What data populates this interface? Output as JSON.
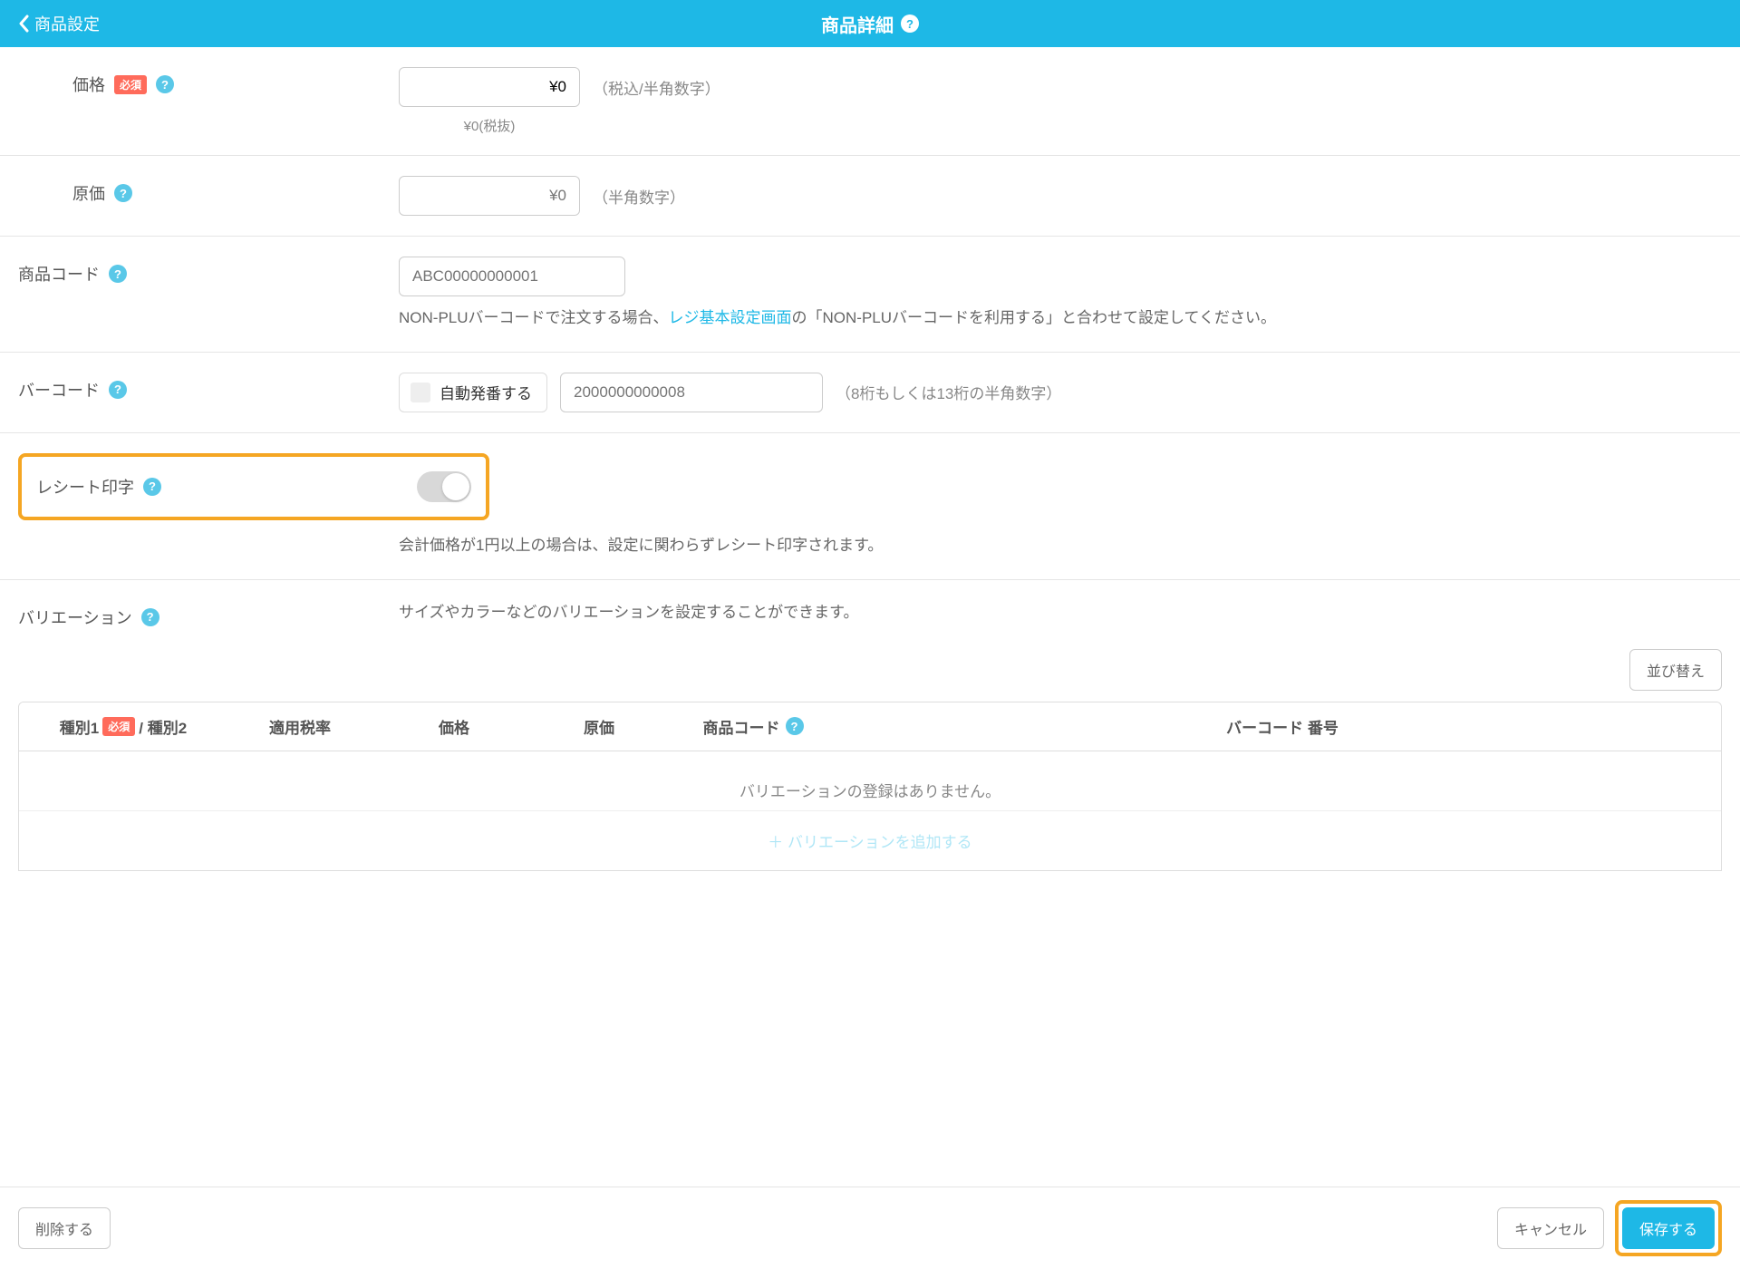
{
  "header": {
    "back": "商品設定",
    "title": "商品詳細"
  },
  "price": {
    "label": "価格",
    "required": "必須",
    "value": "¥0",
    "hint": "（税込/半角数字）",
    "sub": "¥0(税抜)"
  },
  "cost": {
    "label": "原価",
    "placeholder": "¥0",
    "hint": "（半角数字）"
  },
  "code": {
    "label": "商品コード",
    "placeholder": "ABC00000000001",
    "desc1": "NON-PLUバーコードで注文する場合、",
    "link": "レジ基本設定画面",
    "desc2": "の「NON-PLUバーコードを利用する」と合わせて設定してください。"
  },
  "barcode": {
    "label": "バーコード",
    "auto": "自動発番する",
    "placeholder": "2000000000008",
    "hint": "（8桁もしくは13桁の半角数字）"
  },
  "receipt": {
    "label": "レシート印字",
    "desc": "会計価格が1円以上の場合は、設定に関わらずレシート印字されます。"
  },
  "variation": {
    "label": "バリエーション",
    "desc": "サイズやカラーなどのバリエーションを設定することができます。",
    "sort": "並び替え",
    "empty": "バリエーションの登録はありません。",
    "add": "＋ バリエーションを追加する"
  },
  "varhead": {
    "c1a": "種別1",
    "c1req": "必須",
    "c1b": " / 種別2",
    "c2": "適用税率",
    "c3": "価格",
    "c4": "原価",
    "c5": "商品コード",
    "c6": "バーコード 番号"
  },
  "footer": {
    "delete": "削除する",
    "cancel": "キャンセル",
    "save": "保存する"
  }
}
